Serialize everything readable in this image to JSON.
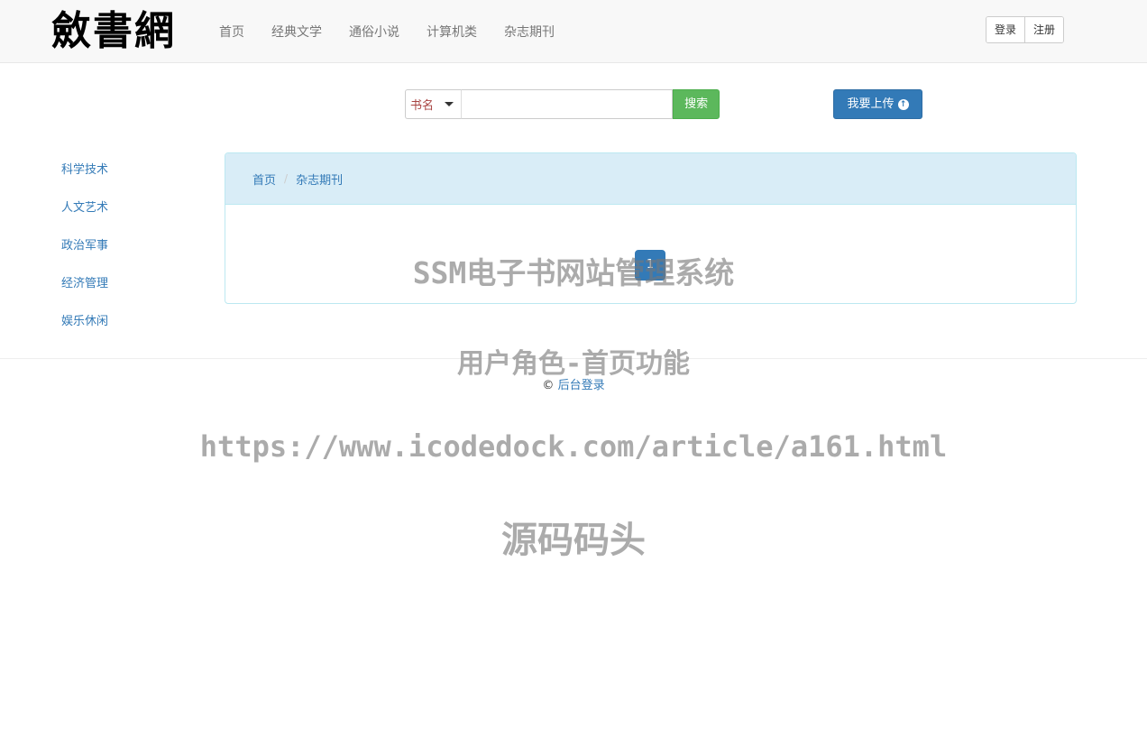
{
  "header": {
    "logo_text": "斂書網",
    "nav": [
      "首页",
      "经典文学",
      "通俗小说",
      "计算机类",
      "杂志期刊"
    ],
    "login_label": "登录",
    "register_label": "注册"
  },
  "search": {
    "type_label": "书名",
    "query_value": "",
    "button_label": "搜索"
  },
  "upload_button": {
    "label": "我要上传",
    "icon": "arrow-up-circle-icon"
  },
  "sidebar": {
    "items": [
      "科学技术",
      "人文艺术",
      "政治军事",
      "经济管理",
      "娱乐休闲"
    ]
  },
  "breadcrumb": {
    "home": "首页",
    "separator": "/",
    "current": "杂志期刊"
  },
  "pagination": {
    "current_page": "1"
  },
  "footer": {
    "copyright_symbol": "©",
    "admin_login_link": "后台登录"
  },
  "watermark": {
    "line1": "SSM电子书网站管理系统",
    "line2": "用户角色-首页功能",
    "line3": "https://www.icodedock.com/article/a161.html",
    "line4": "源码码头"
  },
  "colors": {
    "navbar_bg": "#f8f8f8",
    "link_blue": "#337ab7",
    "search_green": "#5cb85c",
    "panel_heading_bg": "#d9edf7",
    "search_type_text": "#a94442"
  }
}
